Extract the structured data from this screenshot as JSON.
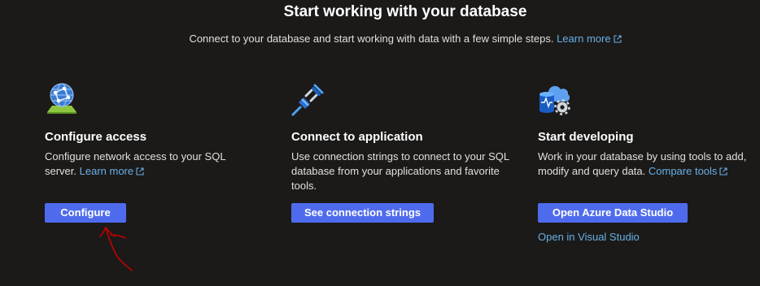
{
  "header": {
    "title": "Start working with your database",
    "subtitle": "Connect to your database and start working with data with a few simple steps.",
    "learn_more": "Learn more"
  },
  "cards": [
    {
      "icon": "globe-network-icon",
      "title": "Configure access",
      "desc_1": "Configure network access to your SQL",
      "desc_2": "server.",
      "link": "Learn more",
      "button": "Configure"
    },
    {
      "icon": "plug-icon",
      "title": "Connect to application",
      "desc_1": "Use connection strings to connect to your SQL",
      "desc_2": "database from your applications and favorite",
      "desc_3": "tools.",
      "button": "See connection strings"
    },
    {
      "icon": "database-gear-icon",
      "title": "Start developing",
      "desc_1": "Work in your database by using tools to add,",
      "desc_2": "modify and query data.",
      "link": "Compare tools",
      "button": "Open Azure Data Studio",
      "secondary_link": "Open in Visual Studio"
    }
  ],
  "colors": {
    "background": "#1b1a19",
    "accent": "#4f6bed",
    "link": "#69afe5",
    "annotation": "#c00000"
  }
}
